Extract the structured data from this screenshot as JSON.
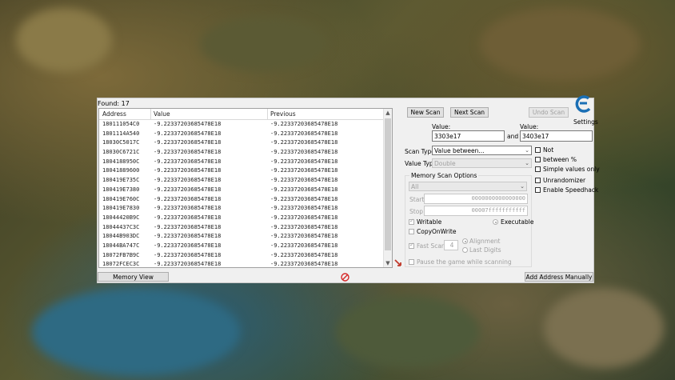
{
  "found_label": "Found: 17",
  "columns": {
    "address": "Address",
    "value": "Value",
    "previous": "Previous"
  },
  "rows": [
    {
      "address": "180111054C0",
      "value": "-9.22337203685478E18",
      "previous": "-9.22337203685478E18"
    },
    {
      "address": "1801114A540",
      "value": "-9.22337203685478E18",
      "previous": "-9.22337203685478E18"
    },
    {
      "address": "18030C5017C",
      "value": "-9.22337203685478E18",
      "previous": "-9.22337203685478E18"
    },
    {
      "address": "18030C6721C",
      "value": "-9.22337203685478E18",
      "previous": "-9.22337203685478E18"
    },
    {
      "address": "1804188950C",
      "value": "-9.22337203685478E18",
      "previous": "-9.22337203685478E18"
    },
    {
      "address": "18041889600",
      "value": "-9.22337203685478E18",
      "previous": "-9.22337203685478E18"
    },
    {
      "address": "180419E735C",
      "value": "-9.22337203685478E18",
      "previous": "-9.22337203685478E18"
    },
    {
      "address": "180419E7380",
      "value": "-9.22337203685478E18",
      "previous": "-9.22337203685478E18"
    },
    {
      "address": "180419E760C",
      "value": "-9.22337203685478E18",
      "previous": "-9.22337203685478E18"
    },
    {
      "address": "180419E7830",
      "value": "-9.22337203685478E18",
      "previous": "-9.22337203685478E18"
    },
    {
      "address": "18044420B9C",
      "value": "-9.22337203685478E18",
      "previous": "-9.22337203685478E18"
    },
    {
      "address": "18044437C3C",
      "value": "-9.22337203685478E18",
      "previous": "-9.22337203685478E18"
    },
    {
      "address": "18044B903DC",
      "value": "-9.22337203685478E18",
      "previous": "-9.22337203685478E18"
    },
    {
      "address": "18044BA747C",
      "value": "-9.22337203685478E18",
      "previous": "-9.22337203685478E18"
    },
    {
      "address": "18072FB7B9C",
      "value": "-9.22337203685478E18",
      "previous": "-9.22337203685478E18"
    },
    {
      "address": "18072FCEC3C",
      "value": "-9.22337203685478E18",
      "previous": "-9.22337203685478E18"
    }
  ],
  "buttons": {
    "new_scan": "New Scan",
    "next_scan": "Next Scan",
    "undo_scan": "Undo Scan",
    "memory_view": "Memory View",
    "add_address": "Add Address Manually"
  },
  "settings_label": "Settings",
  "value1": {
    "label": "Value:",
    "value": "3303e17"
  },
  "and_label": "and",
  "value2": {
    "label": "Value:",
    "value": "3403e17"
  },
  "scan_type": {
    "label": "Scan Type",
    "selected": "Value between..."
  },
  "value_type": {
    "label": "Value Type",
    "selected": "Double"
  },
  "options": {
    "not": "Not",
    "between_pct": "between %",
    "simple_values": "Simple values only",
    "unrandomizer": "Unrandomizer",
    "speedhack": "Enable Speedhack"
  },
  "memory_scan": {
    "title": "Memory Scan Options",
    "region": "All",
    "start_label": "Start",
    "start_value": "0000000000000000",
    "stop_label": "Stop",
    "stop_value": "00007fffffffffff",
    "writable": "Writable",
    "executable": "Executable",
    "copy_on_write": "CopyOnWrite",
    "fast_scan": "Fast Scan",
    "fast_scan_value": "4",
    "alignment": "Alignment",
    "last_digits": "Last Digits",
    "pause_game": "Pause the game while scanning"
  },
  "colors": {
    "accent": "#1a6fb5",
    "stop_icon": "#d62828"
  }
}
